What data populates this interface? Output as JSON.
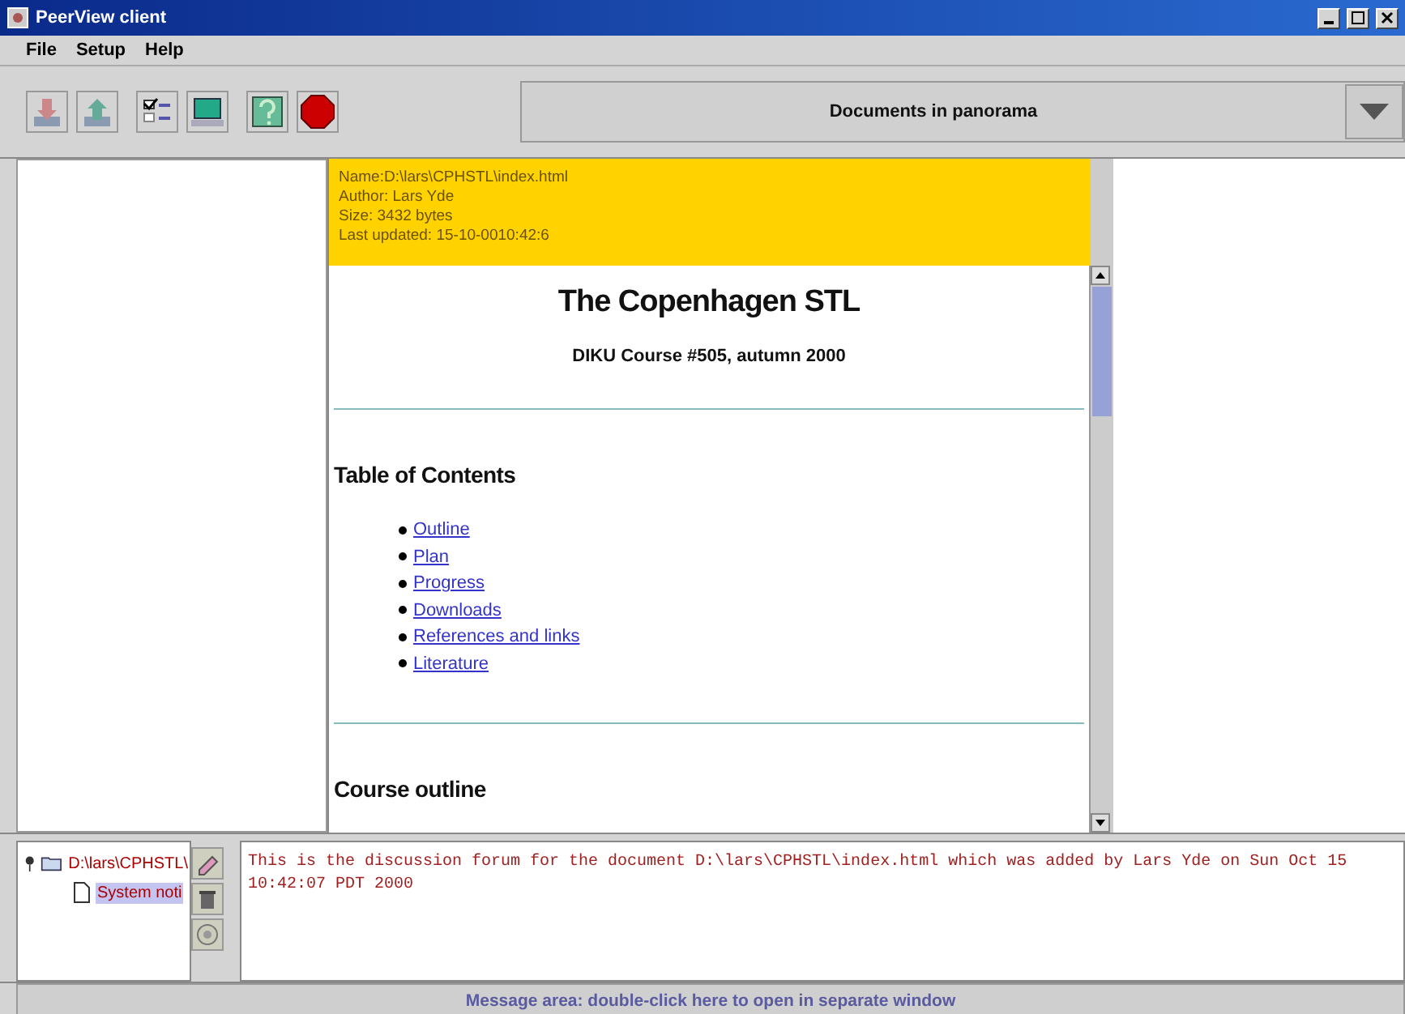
{
  "window": {
    "title": "PeerView client"
  },
  "menu": [
    "File",
    "Setup",
    "Help"
  ],
  "toolbar": {
    "buttons": [
      {
        "kind": "download"
      },
      {
        "kind": "upload"
      },
      {
        "kind": "checklist"
      },
      {
        "kind": "computer"
      },
      {
        "kind": "help"
      },
      {
        "kind": "stop"
      }
    ],
    "panorama": {
      "value": "Documents in panorama"
    }
  },
  "document": {
    "info": [
      "Name:D:\\lars\\CPHSTL\\index.html",
      "Author: Lars Yde",
      "Size: 3432 bytes",
      "Last updated: 15-10-0010:42:6"
    ],
    "title": "The Copenhagen STL",
    "subtitle": "DIKU Course #505, autumn 2000",
    "toc_heading": "Table of Contents",
    "toc": [
      "Outline",
      "Plan",
      "Progress",
      "Downloads",
      "References and links",
      "Literature"
    ],
    "section_heading": "Course outline"
  },
  "forum": {
    "tree": [
      {
        "label": "D:\\lars\\CPHSTL\\",
        "selected": false,
        "children": [
          {
            "label": "System noti",
            "selected": true
          }
        ]
      }
    ],
    "tools": [
      {
        "kind": "edit"
      },
      {
        "kind": "delete"
      },
      {
        "kind": "reply"
      }
    ],
    "message": "This is the discussion forum for the document D:\\lars\\CPHSTL\\index.html which was added by Lars Yde on Sun Oct 15 10:42:07 PDT 2000"
  },
  "status_bar": "Message area: double-click here to open in separate window"
}
